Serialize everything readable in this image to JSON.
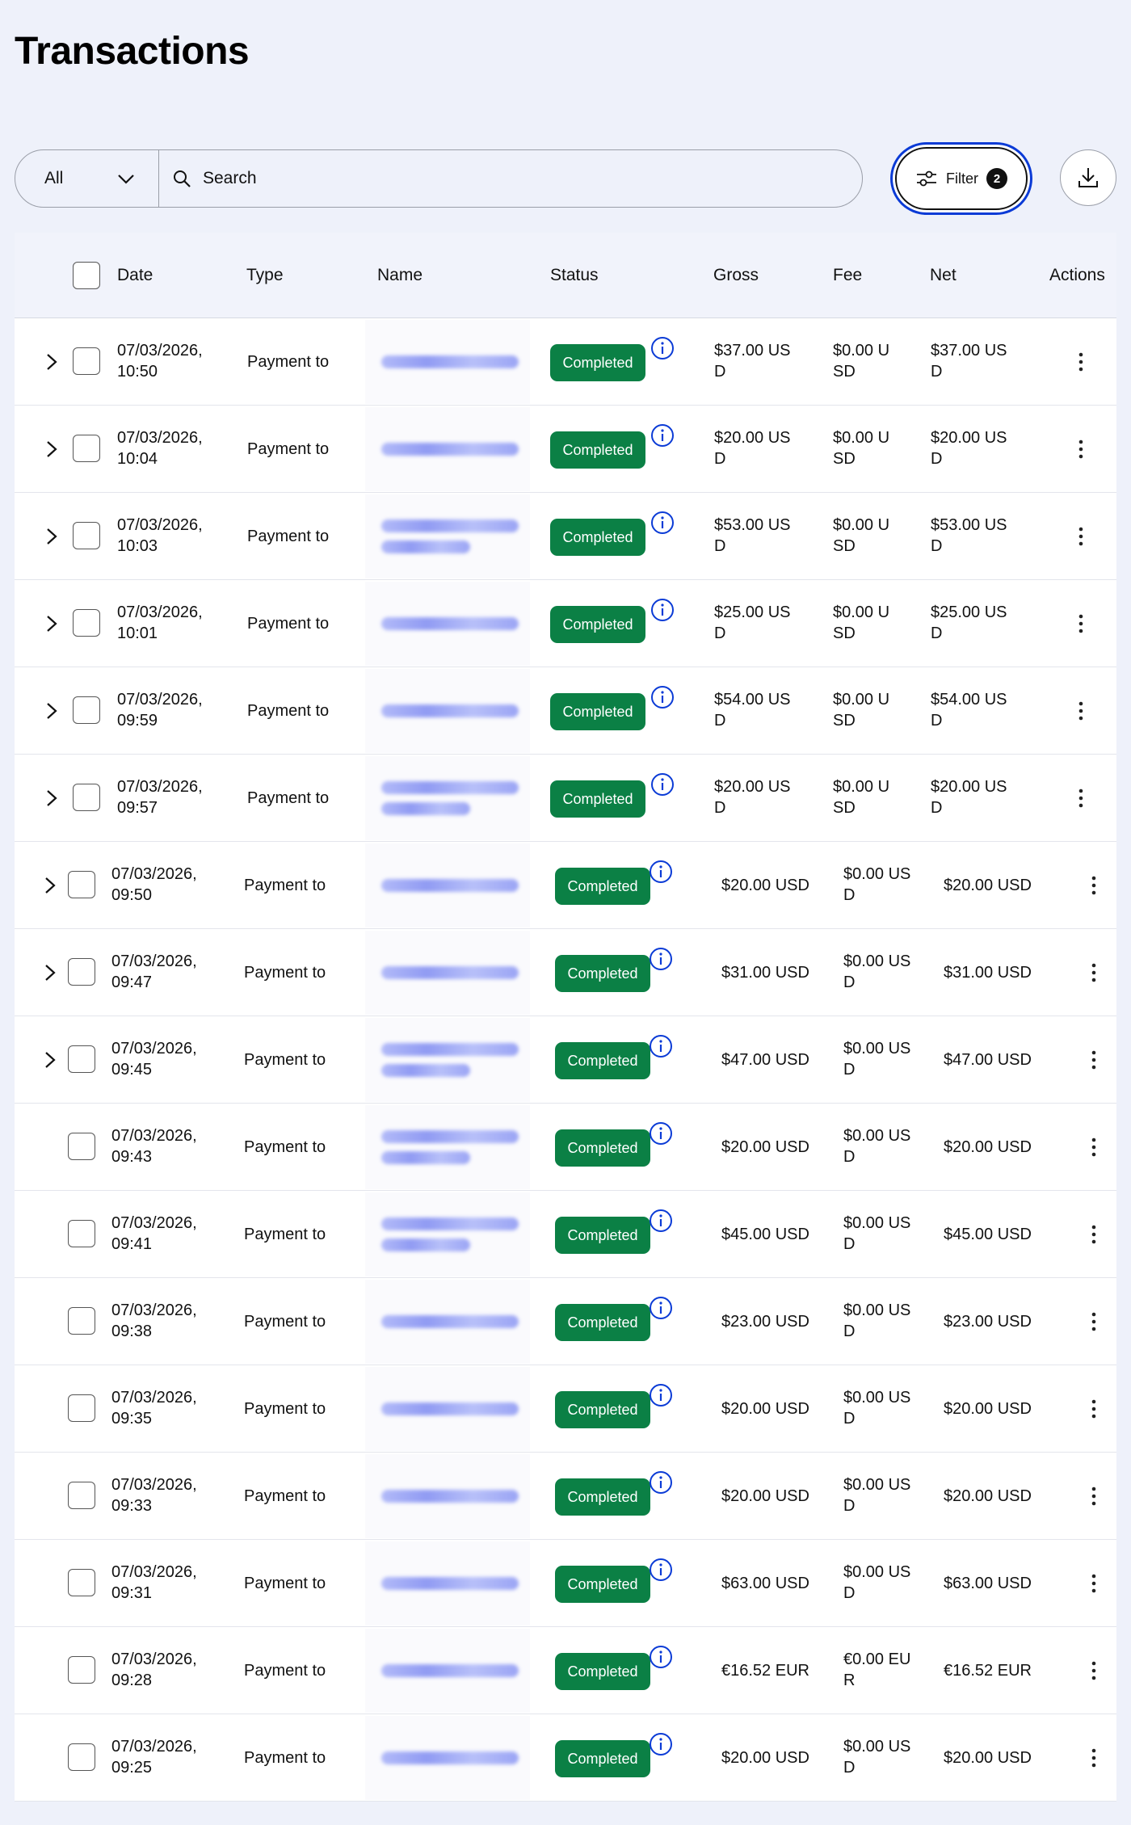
{
  "page": {
    "title": "Transactions"
  },
  "toolbar": {
    "select_value": "All",
    "search_placeholder": "Search",
    "filter_label": "Filter",
    "filter_count": "2"
  },
  "table": {
    "columns": [
      "Date",
      "Type",
      "Name",
      "Status",
      "Gross",
      "Fee",
      "Net",
      "Actions"
    ],
    "status_label": "Completed",
    "rows": [
      {
        "date_line1": "07/03/2026,",
        "date_line2": "10:50",
        "type": "Payment to",
        "gross": "$37.00 US\nD",
        "fee": "$0.00 U\nSD",
        "net": "$37.00 US\nD",
        "expandable": true,
        "narrow": true,
        "name_lines": 1
      },
      {
        "date_line1": "07/03/2026,",
        "date_line2": "10:04",
        "type": "Payment to",
        "gross": "$20.00 US\nD",
        "fee": "$0.00 U\nSD",
        "net": "$20.00 US\nD",
        "expandable": true,
        "narrow": true,
        "name_lines": 1
      },
      {
        "date_line1": "07/03/2026,",
        "date_line2": "10:03",
        "type": "Payment to",
        "gross": "$53.00 US\nD",
        "fee": "$0.00 U\nSD",
        "net": "$53.00 US\nD",
        "expandable": true,
        "narrow": true,
        "name_lines": 2
      },
      {
        "date_line1": "07/03/2026,",
        "date_line2": "10:01",
        "type": "Payment to",
        "gross": "$25.00 US\nD",
        "fee": "$0.00 U\nSD",
        "net": "$25.00 US\nD",
        "expandable": true,
        "narrow": true,
        "name_lines": 1
      },
      {
        "date_line1": "07/03/2026,",
        "date_line2": "09:59",
        "type": "Payment to",
        "gross": "$54.00 US\nD",
        "fee": "$0.00 U\nSD",
        "net": "$54.00 US\nD",
        "expandable": true,
        "narrow": true,
        "name_lines": 1
      },
      {
        "date_line1": "07/03/2026,",
        "date_line2": "09:57",
        "type": "Payment to",
        "gross": "$20.00 US\nD",
        "fee": "$0.00 U\nSD",
        "net": "$20.00 US\nD",
        "expandable": true,
        "narrow": true,
        "name_lines": 2
      },
      {
        "date_line1": "07/03/2026,",
        "date_line2": "09:50",
        "type": "Payment to",
        "gross": "$20.00 USD",
        "fee": "$0.00 US\nD",
        "net": "$20.00 USD",
        "expandable": true,
        "narrow": false,
        "name_lines": 1
      },
      {
        "date_line1": "07/03/2026,",
        "date_line2": "09:47",
        "type": "Payment to",
        "gross": "$31.00 USD",
        "fee": "$0.00 US\nD",
        "net": "$31.00 USD",
        "expandable": true,
        "narrow": false,
        "name_lines": 1
      },
      {
        "date_line1": "07/03/2026,",
        "date_line2": "09:45",
        "type": "Payment to",
        "gross": "$47.00 USD",
        "fee": "$0.00 US\nD",
        "net": "$47.00 USD",
        "expandable": true,
        "narrow": false,
        "name_lines": 2
      },
      {
        "date_line1": "07/03/2026,",
        "date_line2": "09:43",
        "type": "Payment to",
        "gross": "$20.00 USD",
        "fee": "$0.00 US\nD",
        "net": "$20.00 USD",
        "expandable": false,
        "narrow": false,
        "name_lines": 2
      },
      {
        "date_line1": "07/03/2026,",
        "date_line2": "09:41",
        "type": "Payment to",
        "gross": "$45.00 USD",
        "fee": "$0.00 US\nD",
        "net": "$45.00 USD",
        "expandable": false,
        "narrow": false,
        "name_lines": 2
      },
      {
        "date_line1": "07/03/2026,",
        "date_line2": "09:38",
        "type": "Payment to",
        "gross": "$23.00 USD",
        "fee": "$0.00 US\nD",
        "net": "$23.00 USD",
        "expandable": false,
        "narrow": false,
        "name_lines": 1
      },
      {
        "date_line1": "07/03/2026,",
        "date_line2": "09:35",
        "type": "Payment to",
        "gross": "$20.00 USD",
        "fee": "$0.00 US\nD",
        "net": "$20.00 USD",
        "expandable": false,
        "narrow": false,
        "name_lines": 1
      },
      {
        "date_line1": "07/03/2026,",
        "date_line2": "09:33",
        "type": "Payment to",
        "gross": "$20.00 USD",
        "fee": "$0.00 US\nD",
        "net": "$20.00 USD",
        "expandable": false,
        "narrow": false,
        "name_lines": 1
      },
      {
        "date_line1": "07/03/2026,",
        "date_line2": "09:31",
        "type": "Payment to",
        "gross": "$63.00 USD",
        "fee": "$0.00 US\nD",
        "net": "$63.00 USD",
        "expandable": false,
        "narrow": false,
        "name_lines": 1
      },
      {
        "date_line1": "07/03/2026,",
        "date_line2": "09:28",
        "type": "Payment to",
        "gross": "€16.52 EUR",
        "fee": "€0.00 EU\nR",
        "net": "€16.52 EUR",
        "expandable": false,
        "narrow": false,
        "name_lines": 1
      },
      {
        "date_line1": "07/03/2026,",
        "date_line2": "09:25",
        "type": "Payment to",
        "gross": "$20.00 USD",
        "fee": "$0.00 US\nD",
        "net": "$20.00 USD",
        "expandable": false,
        "narrow": false,
        "name_lines": 1
      }
    ]
  },
  "colors": {
    "status_green": "#0b8045",
    "info_blue": "#0b3bd6",
    "focus_ring": "#0b3bd6",
    "page_bg": "#eef1fa"
  },
  "icons": [
    "chevron-down-icon",
    "search-icon",
    "filter-sliders-icon",
    "download-icon",
    "chevron-right-icon",
    "info-icon",
    "kebab-menu-icon"
  ]
}
